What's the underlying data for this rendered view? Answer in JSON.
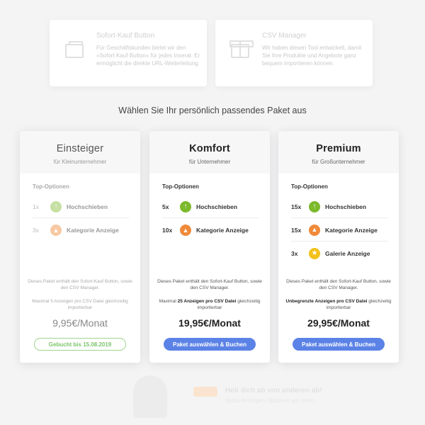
{
  "features": [
    {
      "title": "Sofort-Kauf Button",
      "body": "Für Geschäftskunden bietet wir den »Sofort Kauf Button« für jedes Inserat. Er ermöglicht die direkte URL-Weiterleitung."
    },
    {
      "title": "CSV Manager",
      "body": "Wir haben diesen Tool entwickelt, damit Sie Ihre Produkte und Angebote ganz bequem importieren können."
    }
  ],
  "heading": "Wählen Sie Ihr persönlich passendes Paket aus",
  "plans": [
    {
      "title": "Einsteiger",
      "subtitle": "für Kleinunternehmer",
      "options_label": "Top-Optionen",
      "options": [
        {
          "count": "1x",
          "icon": "arrow-up-icon",
          "name": "Hochschieben"
        },
        {
          "count": "3x",
          "icon": "flame-icon",
          "name": "Kategorie Anzeige"
        }
      ],
      "note": "Dieses Paket enthält den Sofort-Kauf Button, sowie den CSV Manager.",
      "csv_prefix": "Maximal",
      "csv_strong": "5 Anzeigen pro CSV Datei",
      "csv_suffix": "gleichzeitig importierbar",
      "price": "9,95€/Monat",
      "button": "Gebucht bis 15.08.2019"
    },
    {
      "title": "Komfort",
      "subtitle": "für Unternehmer",
      "options_label": "Top-Optionen",
      "options": [
        {
          "count": "5x",
          "icon": "arrow-up-icon",
          "name": "Hochschieben"
        },
        {
          "count": "10x",
          "icon": "flame-icon",
          "name": "Kategorie Anzeige"
        }
      ],
      "note": "Dieses Paket enthält den Sofort-Kauf Button, sowie den CSV Manager.",
      "csv_prefix": "Maximal",
      "csv_strong": "25 Anzeigen pro CSV Datei",
      "csv_suffix": "gleichzeitig importierbar",
      "price": "19,95€/Monat",
      "button": "Paket auswählen & Buchen"
    },
    {
      "title": "Premium",
      "subtitle": "für Großunternehmer",
      "options_label": "Top-Optionen",
      "options": [
        {
          "count": "15x",
          "icon": "arrow-up-icon",
          "name": "Hochschieben"
        },
        {
          "count": "15x",
          "icon": "flame-icon",
          "name": "Kategorie Anzeige"
        },
        {
          "count": "3x",
          "icon": "star-icon",
          "name": "Galerie Anzeige"
        }
      ],
      "note": "Dieses Paket enthält den Sofort-Kauf Button, sowie den CSV Manager.",
      "csv_prefix": "",
      "csv_strong": "Unbegrenzte Anzeigen pro CSV Datei",
      "csv_suffix": "gleichzeitig importierbar",
      "price": "29,95€/Monat",
      "button": "Paket auswählen & Buchen"
    }
  ],
  "promo": {
    "title": "Heb dich ab von anderen ab!",
    "subtitle": "Nutze Anzeigen Optionen um mehr..."
  },
  "colors": {
    "accent_blue": "#5b82e6",
    "booked_green": "#7cc46a",
    "up_green": "#7cb92c",
    "flame_orange": "#f08a3a",
    "star_yellow": "#f3c11b"
  }
}
